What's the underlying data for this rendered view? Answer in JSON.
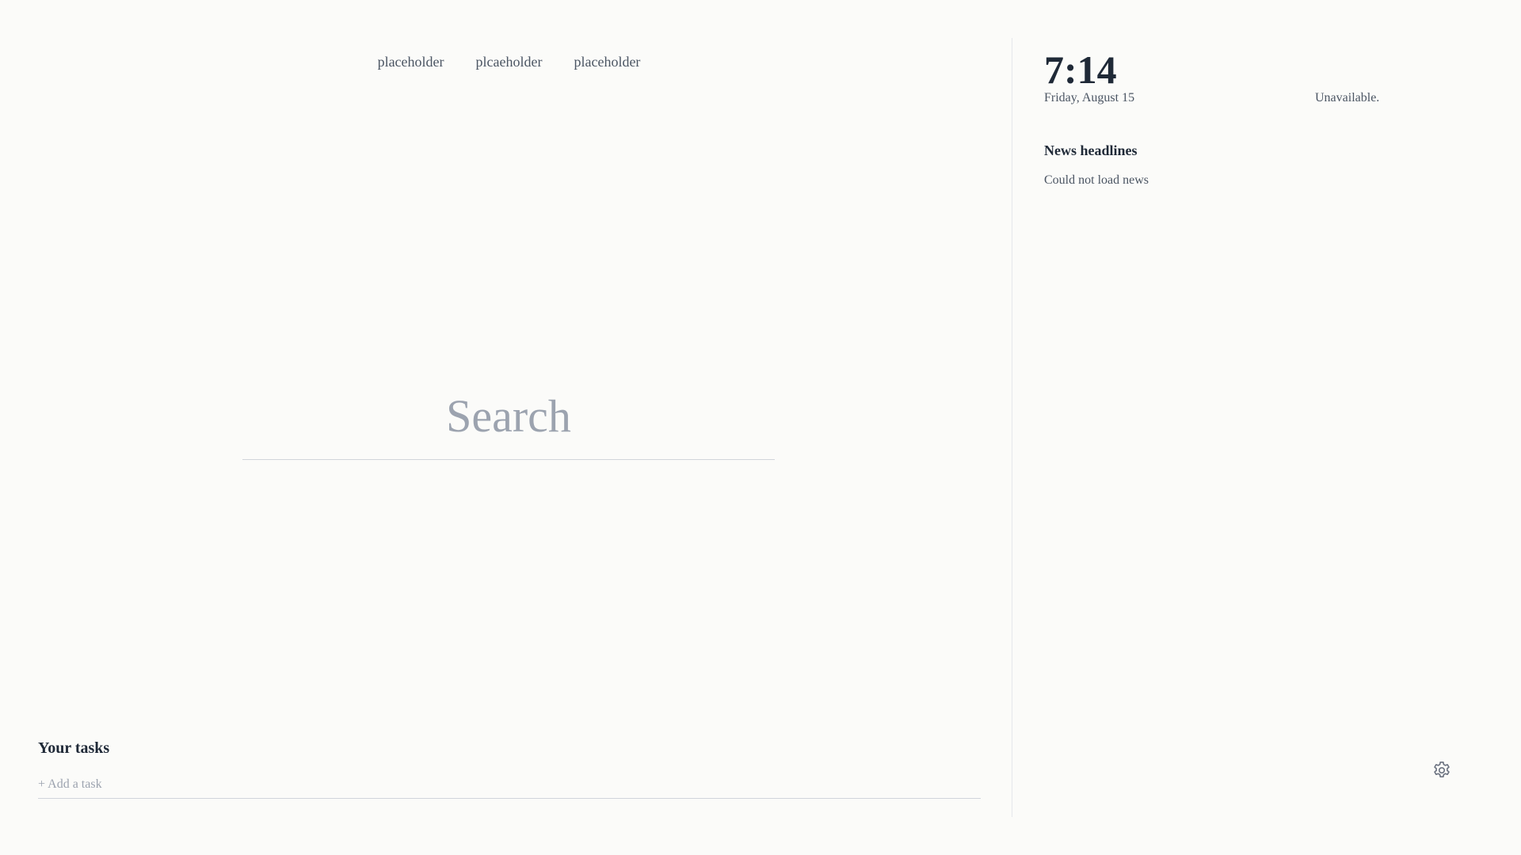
{
  "nav": {
    "links": [
      {
        "label": "placeholder"
      },
      {
        "label": "plcaeholder"
      },
      {
        "label": "placeholder"
      }
    ]
  },
  "search": {
    "placeholder": "Search",
    "value": ""
  },
  "tasks": {
    "title": "Your tasks",
    "add_placeholder": "+ Add a task"
  },
  "side": {
    "clock": "7:14",
    "date": "Friday, August 15",
    "weather": "Unavailable.",
    "news_title": "News headlines",
    "news_status": "Could not load news"
  },
  "icons": {
    "settings": "gear-icon"
  },
  "colors": {
    "background": "#fbfbf9",
    "text_primary": "#1f2937",
    "text_secondary": "#4b5563",
    "placeholder": "#9ca3af",
    "divider": "#e5e7eb"
  }
}
